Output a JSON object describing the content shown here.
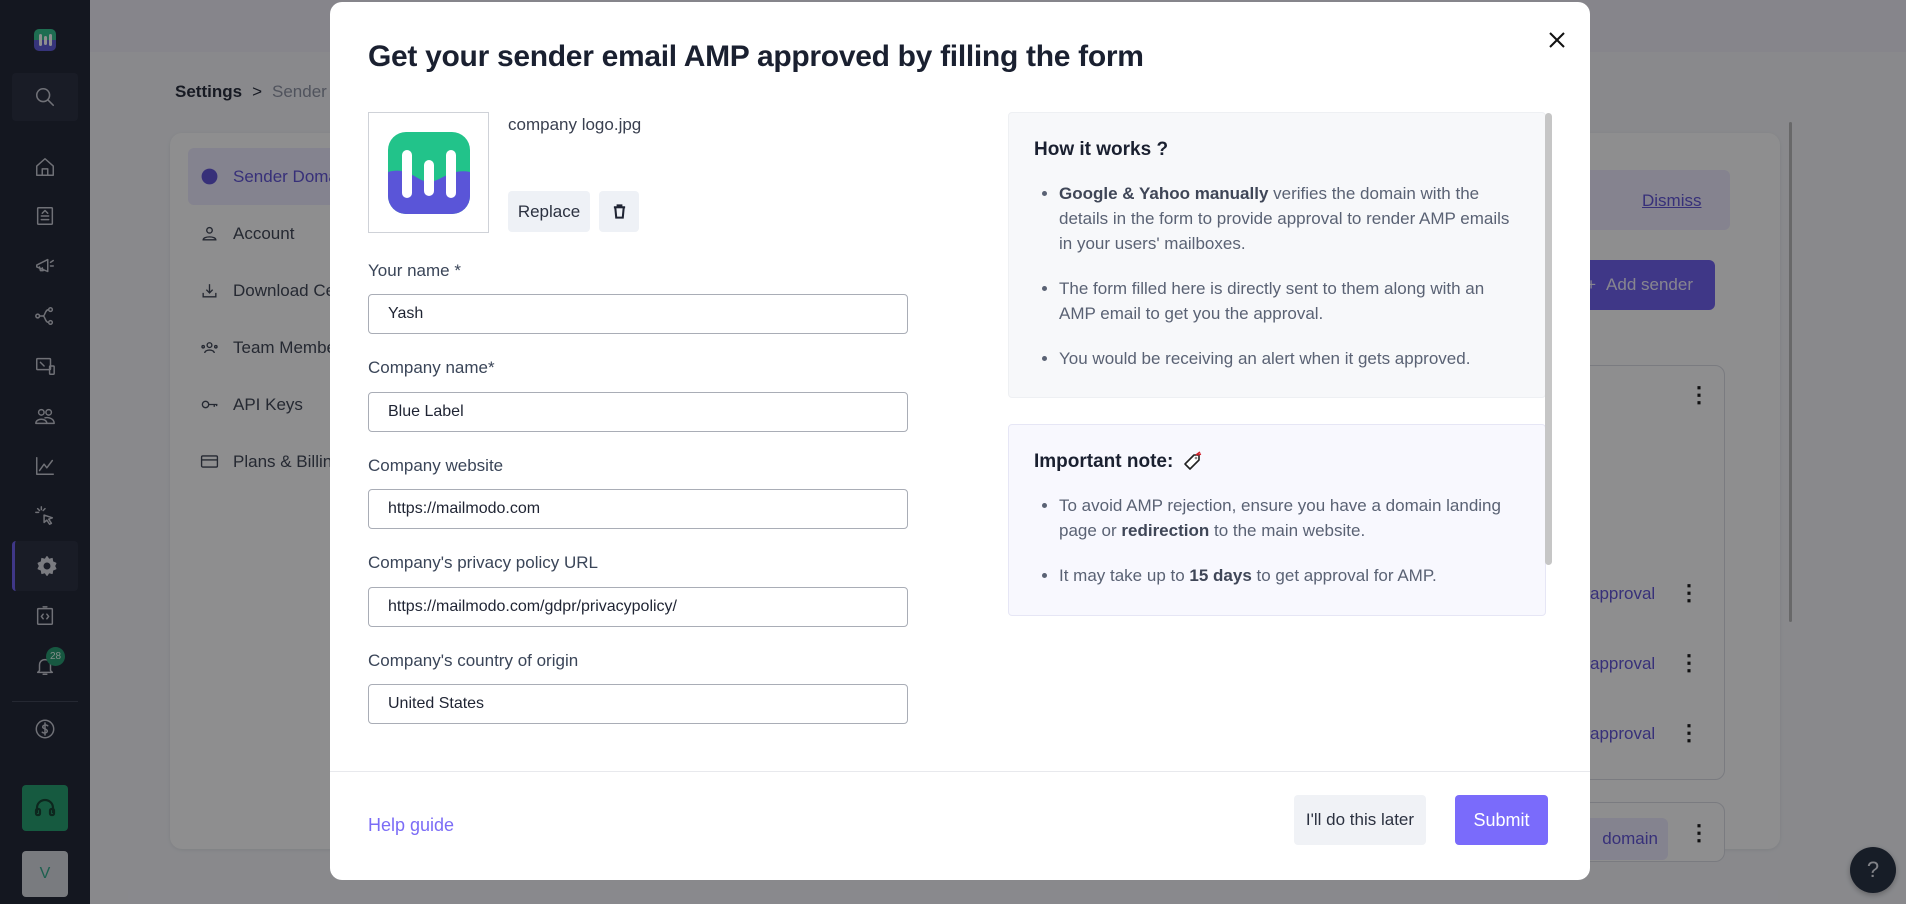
{
  "nav": {
    "items": [
      {
        "icon": "search-icon"
      },
      {
        "icon": "home-icon"
      },
      {
        "icon": "templates-icon"
      },
      {
        "icon": "campaigns-icon"
      },
      {
        "icon": "journeys-icon"
      },
      {
        "icon": "widgets-icon"
      },
      {
        "icon": "audience-icon"
      },
      {
        "icon": "analytics-icon"
      },
      {
        "icon": "click-icon"
      },
      {
        "icon": "settings-icon",
        "active": true
      },
      {
        "icon": "code-icon"
      },
      {
        "icon": "notifications-icon"
      },
      {
        "icon": "billing-icon"
      }
    ],
    "notification_count": "28",
    "avatar_initial": "V"
  },
  "background": {
    "breadcrumb": {
      "root": "Settings",
      "separator": ">",
      "current": "Sender"
    },
    "side_menu": [
      {
        "label": "Sender Domains",
        "active": true
      },
      {
        "label": "Account"
      },
      {
        "label": "Download Center"
      },
      {
        "label": "Team Members"
      },
      {
        "label": "API Keys"
      },
      {
        "label": "Plans & Billing"
      }
    ],
    "dismiss_label": "Dismiss",
    "add_sender_label": "Add sender",
    "add_sender_prefix": "+",
    "approval_labels": [
      "approval",
      "approval",
      "approval"
    ],
    "domain_chip_label": "domain",
    "help_fab_label": "?"
  },
  "modal": {
    "title": "Get your sender email AMP approved by filling the form",
    "logo": {
      "file_name": "company logo.jpg",
      "replace_label": "Replace",
      "brand_colors": {
        "top": "#2cc08a",
        "bottom": "#5a55d8"
      }
    },
    "fields": [
      {
        "label": "Your name *",
        "value": "Yash"
      },
      {
        "label": "Company name*",
        "value": "Blue Label"
      },
      {
        "label": "Company website",
        "value": "https://mailmodo.com"
      },
      {
        "label": "Company's privacy policy URL",
        "value": "https://mailmodo.com/gdpr/privacypolicy/"
      },
      {
        "label": "Company's country of origin",
        "value": "United States"
      }
    ],
    "how_it_works": {
      "title": "How it works ?",
      "items": [
        {
          "bold": "Google & Yahoo manually",
          "text": " verifies the domain with the details in the form to provide approval to render AMP emails in your users' mailboxes."
        },
        {
          "bold": "",
          "text": "The form filled here is directly sent to them along with an AMP email to get you the approval."
        },
        {
          "bold": "",
          "text": "You would be receiving an alert when it gets approved."
        }
      ]
    },
    "important_note": {
      "title": "Important note:",
      "icon": "tag-icon",
      "items": [
        {
          "pre": "To avoid AMP rejection, ensure you have a domain landing page or ",
          "bold": "redirection",
          "post": " to the main website."
        },
        {
          "pre": "It may take up to ",
          "bold": "15 days",
          "post": " to get approval for AMP."
        }
      ]
    },
    "footer": {
      "help_label": "Help guide",
      "later_label": "I'll do this later",
      "submit_label": "Submit"
    },
    "colors": {
      "accent": "#7a6bfb",
      "link": "#7b6cf6"
    }
  }
}
